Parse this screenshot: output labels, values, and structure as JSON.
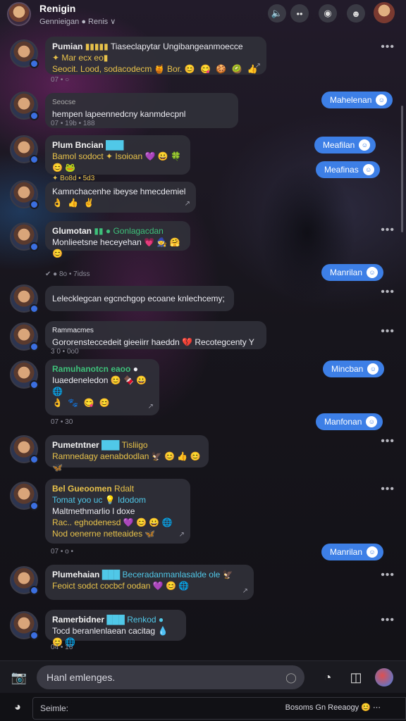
{
  "header": {
    "title": "Renigin",
    "subtitle": "Gennieigan  ● Renis ∨"
  },
  "messages": [
    {
      "name": "Pumian",
      "tag": "▮▮▮▮▮",
      "line1": "Tiaseclapytar Ungibangeanmoecce",
      "line2": "✦ Mar ecx eo▮",
      "line3": "Seocit. Lood, sodacodecm 🍯 Bor.",
      "emoji": "😊 😋 🍪 🥝 👍",
      "meta": "07 • ○"
    },
    {
      "name": "Seocse",
      "line1": "hempen lapeennedcny kanmdecpnl",
      "meta": "07 •  19b  • 188"
    },
    {
      "name": "Plum Bncian",
      "tag": "███",
      "line1": "Bamol sodoct ✦ Isoioan 💜 😀 🍀 😊 🐸",
      "line2": "✦ Bo8d • 5d3",
      "meta": ""
    },
    {
      "name": "",
      "line1": "Kamnchacenhe ibeyse hmecdemiel",
      "line2": "👌 👍 ✌",
      "meta": ""
    },
    {
      "name": "Glumotan",
      "tag": "▮▮  ●  Gonlagacdan",
      "line1": "Monlieetsne heceyehan 💗 🧙 🤗 😊",
      "meta": "✔ ●  8o  • 7idss"
    },
    {
      "name": "",
      "line1": "Lelecklegcan egcnchgop ecoane knlechcemy;",
      "meta": ""
    },
    {
      "name": "Rammacmes",
      "line1": "Gororensteccedeit gieeiirr haeddn 💔 Recotegcenty Y",
      "meta": "3 0  •  0o0"
    },
    {
      "name": "Ramuhanotcn eaoo",
      "tag": "●",
      "line1": "Iuaedeneledon 😊 🍫 😀 🌐",
      "line2": "👌 🐾 😋 😊",
      "meta": "07 •  30"
    },
    {
      "name": "Pumetntner",
      "tag": "███",
      "line1": "Tisliigo",
      "line2": "Ramnedagy aenabdodlan 🦅 😊 👍 😊 🦋",
      "meta": ""
    },
    {
      "name": "Bel Gueoomen",
      "tag": "Rdalt",
      "line1": "Tomat yoo  uc 💡 Idodom",
      "line2": "Maltmethmarlio l doxe",
      "line3": "Rac..  eghodenesd 💜 😊 😀 🌐",
      "line4": "Nod oenerne netteaides 🦋",
      "meta": "07 •  o  •"
    },
    {
      "name": "Plumehaian",
      "tag": "███ Beceradanmanlasalde ole 🦅",
      "line1": "Feoict sodct cocbcf oodan 💜 😊 🌐",
      "meta": ""
    },
    {
      "name": "Ramerbidner",
      "tag": "███ Renkod ●",
      "line1": "Tocd beranlenlaean cacitag 💧 😊 🌐",
      "meta": "04 •  16"
    }
  ],
  "outgoing": [
    "Mahelenan",
    "Meafilan",
    "Meafinas",
    "Manrilan",
    "Mincban",
    "Manfonan",
    "Manrilan"
  ],
  "composer": {
    "placeholder": "Hanl emlenges."
  },
  "bottombar": {
    "search_label": "Seimle:",
    "right_text": "Bosoms  Gn   Reeaogy 😊 ⋯"
  }
}
